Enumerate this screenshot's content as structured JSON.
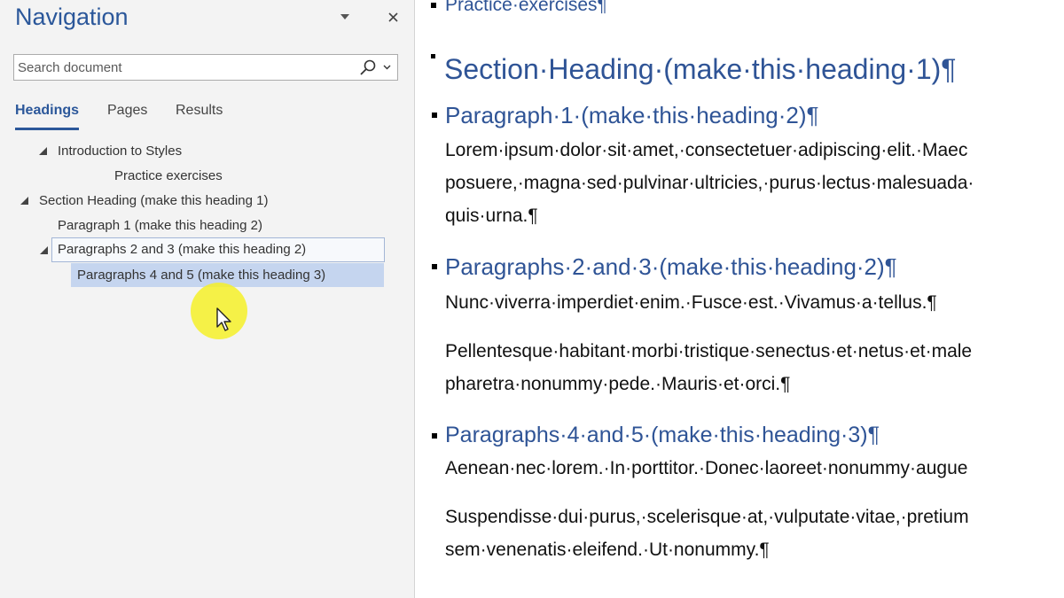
{
  "nav": {
    "title": "Navigation",
    "search_placeholder": "Search document",
    "tabs": [
      {
        "label": "Headings",
        "active": true
      },
      {
        "label": "Pages",
        "active": false
      },
      {
        "label": "Results",
        "active": false
      }
    ],
    "tree": [
      {
        "label": "Introduction to Styles",
        "level": 2,
        "expanded": true
      },
      {
        "label": "Practice exercises",
        "level": 3
      },
      {
        "label": "Section Heading (make this heading 1)",
        "level": 1,
        "expanded": true
      },
      {
        "label": "Paragraph 1 (make this heading 2)",
        "level": 2
      },
      {
        "label": "Paragraphs 2 and 3 (make this heading 2)",
        "level": 2,
        "expanded": true,
        "state": "focused"
      },
      {
        "label": "Paragraphs 4 and 5 (make this heading 3)",
        "level": 3,
        "state": "selected"
      }
    ]
  },
  "document": {
    "top_heading": "Practice·exercises¶",
    "section_heading": "Section·Heading·(make·this·heading·1)¶",
    "p1_heading": "Paragraph·1·(make·this·heading·2)¶",
    "p1_lines": [
      "Lorem·ipsum·dolor·sit·amet,·consectetuer·adipiscing·elit.·Maec",
      "posuere,·magna·sed·pulvinar·ultricies,·purus·lectus·malesuada·",
      "quis·urna.¶"
    ],
    "p23_heading": "Paragraphs·2·and·3·(make·this·heading·2)¶",
    "p2_line": "Nunc·viverra·imperdiet·enim.·Fusce·est.·Vivamus·a·tellus.¶",
    "p3_lines": [
      "Pellentesque·habitant·morbi·tristique·senectus·et·netus·et·male",
      "pharetra·nonummy·pede.·Mauris·et·orci.¶"
    ],
    "p45_heading": "Paragraphs·4·and·5·(make·this·heading·3)¶",
    "p4_line": "Aenean·nec·lorem.·In·porttitor.·Donec·laoreet·nonummy·augue",
    "p5_lines": [
      "Suspendisse·dui·purus,·scelerisque·at,·vulputate·vitae,·pretium",
      "sem·venenatis·eleifend.·Ut·nonummy.¶"
    ]
  },
  "colors": {
    "accent": "#2b579a",
    "heading": "#2f5496",
    "selected_row": "#c5d5ef",
    "cursor_highlight": "#f5f028"
  }
}
